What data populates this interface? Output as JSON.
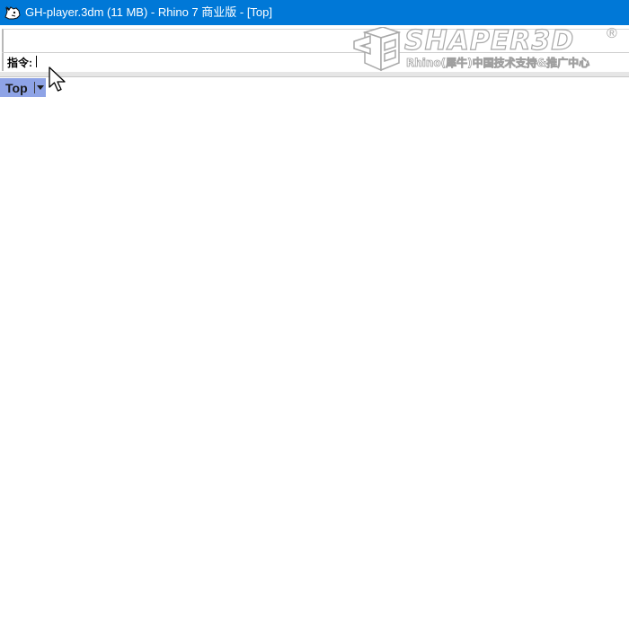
{
  "window": {
    "title": "GH-player.3dm (11 MB) - Rhino 7 商业版 - [Top]",
    "app_icon": "rhino-icon"
  },
  "command_area": {
    "prompt_label": "指令:",
    "input_value": ""
  },
  "watermark": {
    "brand": "SHAPER3D",
    "registered_mark": "®",
    "subtitle": "Rhino(犀牛)中国技术支持&推广中心"
  },
  "viewport": {
    "tab_label": "Top",
    "tab_menu_icon": "chevron-down-icon"
  },
  "colors": {
    "titlebar": "#0078d7",
    "tab_active": "#8ea3e6",
    "viewport_bg": "#ffffff"
  }
}
